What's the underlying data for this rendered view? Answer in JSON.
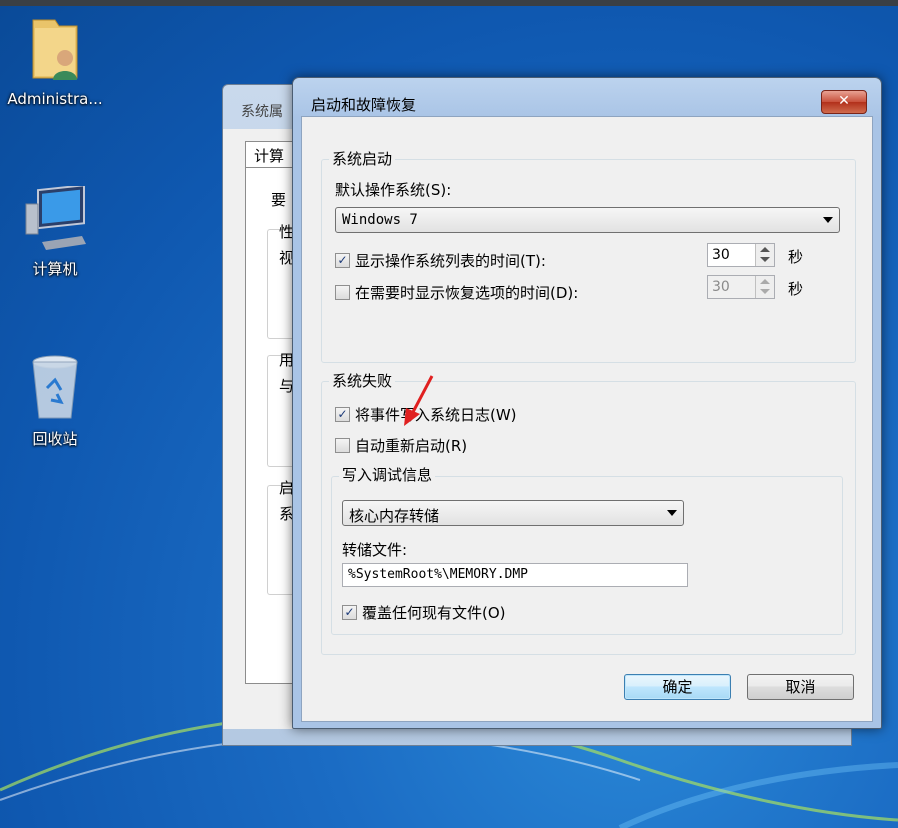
{
  "desktop": {
    "icons": [
      {
        "label": "Administra...",
        "icon": "user-folder-icon"
      },
      {
        "label": "计算机",
        "icon": "computer-icon"
      },
      {
        "label": "回收站",
        "icon": "recycle-bin-icon"
      }
    ]
  },
  "background_window": {
    "title": "系统属",
    "tab": "计算",
    "fragments": [
      "要",
      "性",
      "视",
      "用",
      "与",
      "启",
      "系"
    ]
  },
  "dialog": {
    "title": "启动和故障恢复",
    "close_label": "✕",
    "system_startup": {
      "group_title": "系统启动",
      "default_os_label": "默认操作系统(S):",
      "default_os_value": "Windows 7",
      "show_os_list": {
        "label": "显示操作系统列表的时间(T):",
        "checked": true,
        "value": "30",
        "unit": "秒"
      },
      "show_recovery": {
        "label": "在需要时显示恢复选项的时间(D):",
        "checked": false,
        "value": "30",
        "unit": "秒"
      }
    },
    "system_failure": {
      "group_title": "系统失败",
      "write_event": {
        "label": "将事件写入系统日志(W)",
        "checked": true
      },
      "auto_restart": {
        "label": "自动重新启动(R)",
        "checked": false
      },
      "debug_info": {
        "group_title": "写入调试信息",
        "dump_type": "核心内存转储",
        "dump_file_label": "转储文件:",
        "dump_file_value": "%SystemRoot%\\MEMORY.DMP",
        "overwrite": {
          "label": "覆盖任何现有文件(O)",
          "checked": true
        }
      }
    },
    "ok_label": "确定",
    "cancel_label": "取消"
  },
  "colors": {
    "desktop": "#1b6cc4",
    "annotation_arrow": "#e02020",
    "close_button": "#c8503b"
  }
}
